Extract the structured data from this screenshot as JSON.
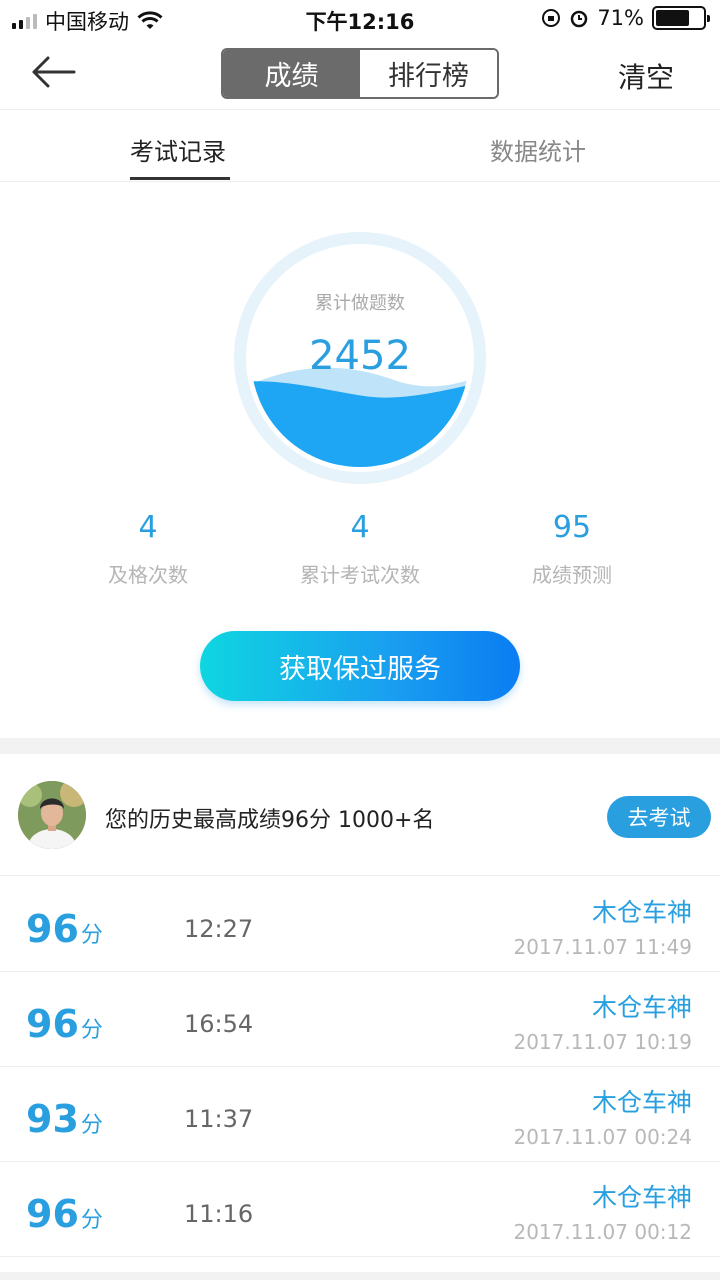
{
  "status_bar": {
    "carrier": "中国移动",
    "time": "下午12:16",
    "battery": "71%",
    "battery_level": 0.71
  },
  "header": {
    "back_icon": "arrow-left-icon",
    "segment_active": "成绩",
    "segment_inactive": "排行榜",
    "clear_label": "清空"
  },
  "tabs": {
    "records": "考试记录",
    "statistics": "数据统计"
  },
  "summary": {
    "circle_label": "累计做题数",
    "circle_value": "2452",
    "stats": [
      {
        "value": "4",
        "label": "及格次数"
      },
      {
        "value": "4",
        "label": "累计考试次数"
      },
      {
        "value": "95",
        "label": "成绩预测"
      }
    ],
    "cta_label": "获取保过服务"
  },
  "best": {
    "text": "您的历史最高成绩96分 1000+名",
    "button_label": "去考试"
  },
  "records": [
    {
      "score": "96",
      "unit": "分",
      "duration": "12:27",
      "name": "木仓车神",
      "date": "2017.11.07 11:49"
    },
    {
      "score": "96",
      "unit": "分",
      "duration": "16:54",
      "name": "木仓车神",
      "date": "2017.11.07 10:19"
    },
    {
      "score": "93",
      "unit": "分",
      "duration": "11:37",
      "name": "木仓车神",
      "date": "2017.11.07 00:24"
    },
    {
      "score": "96",
      "unit": "分",
      "duration": "11:16",
      "name": "木仓车神",
      "date": "2017.11.07 00:12"
    }
  ],
  "colors": {
    "accent": "#2a9fe0",
    "wave": "#1ea5f3",
    "gray_segment": "#6b6b6b"
  }
}
